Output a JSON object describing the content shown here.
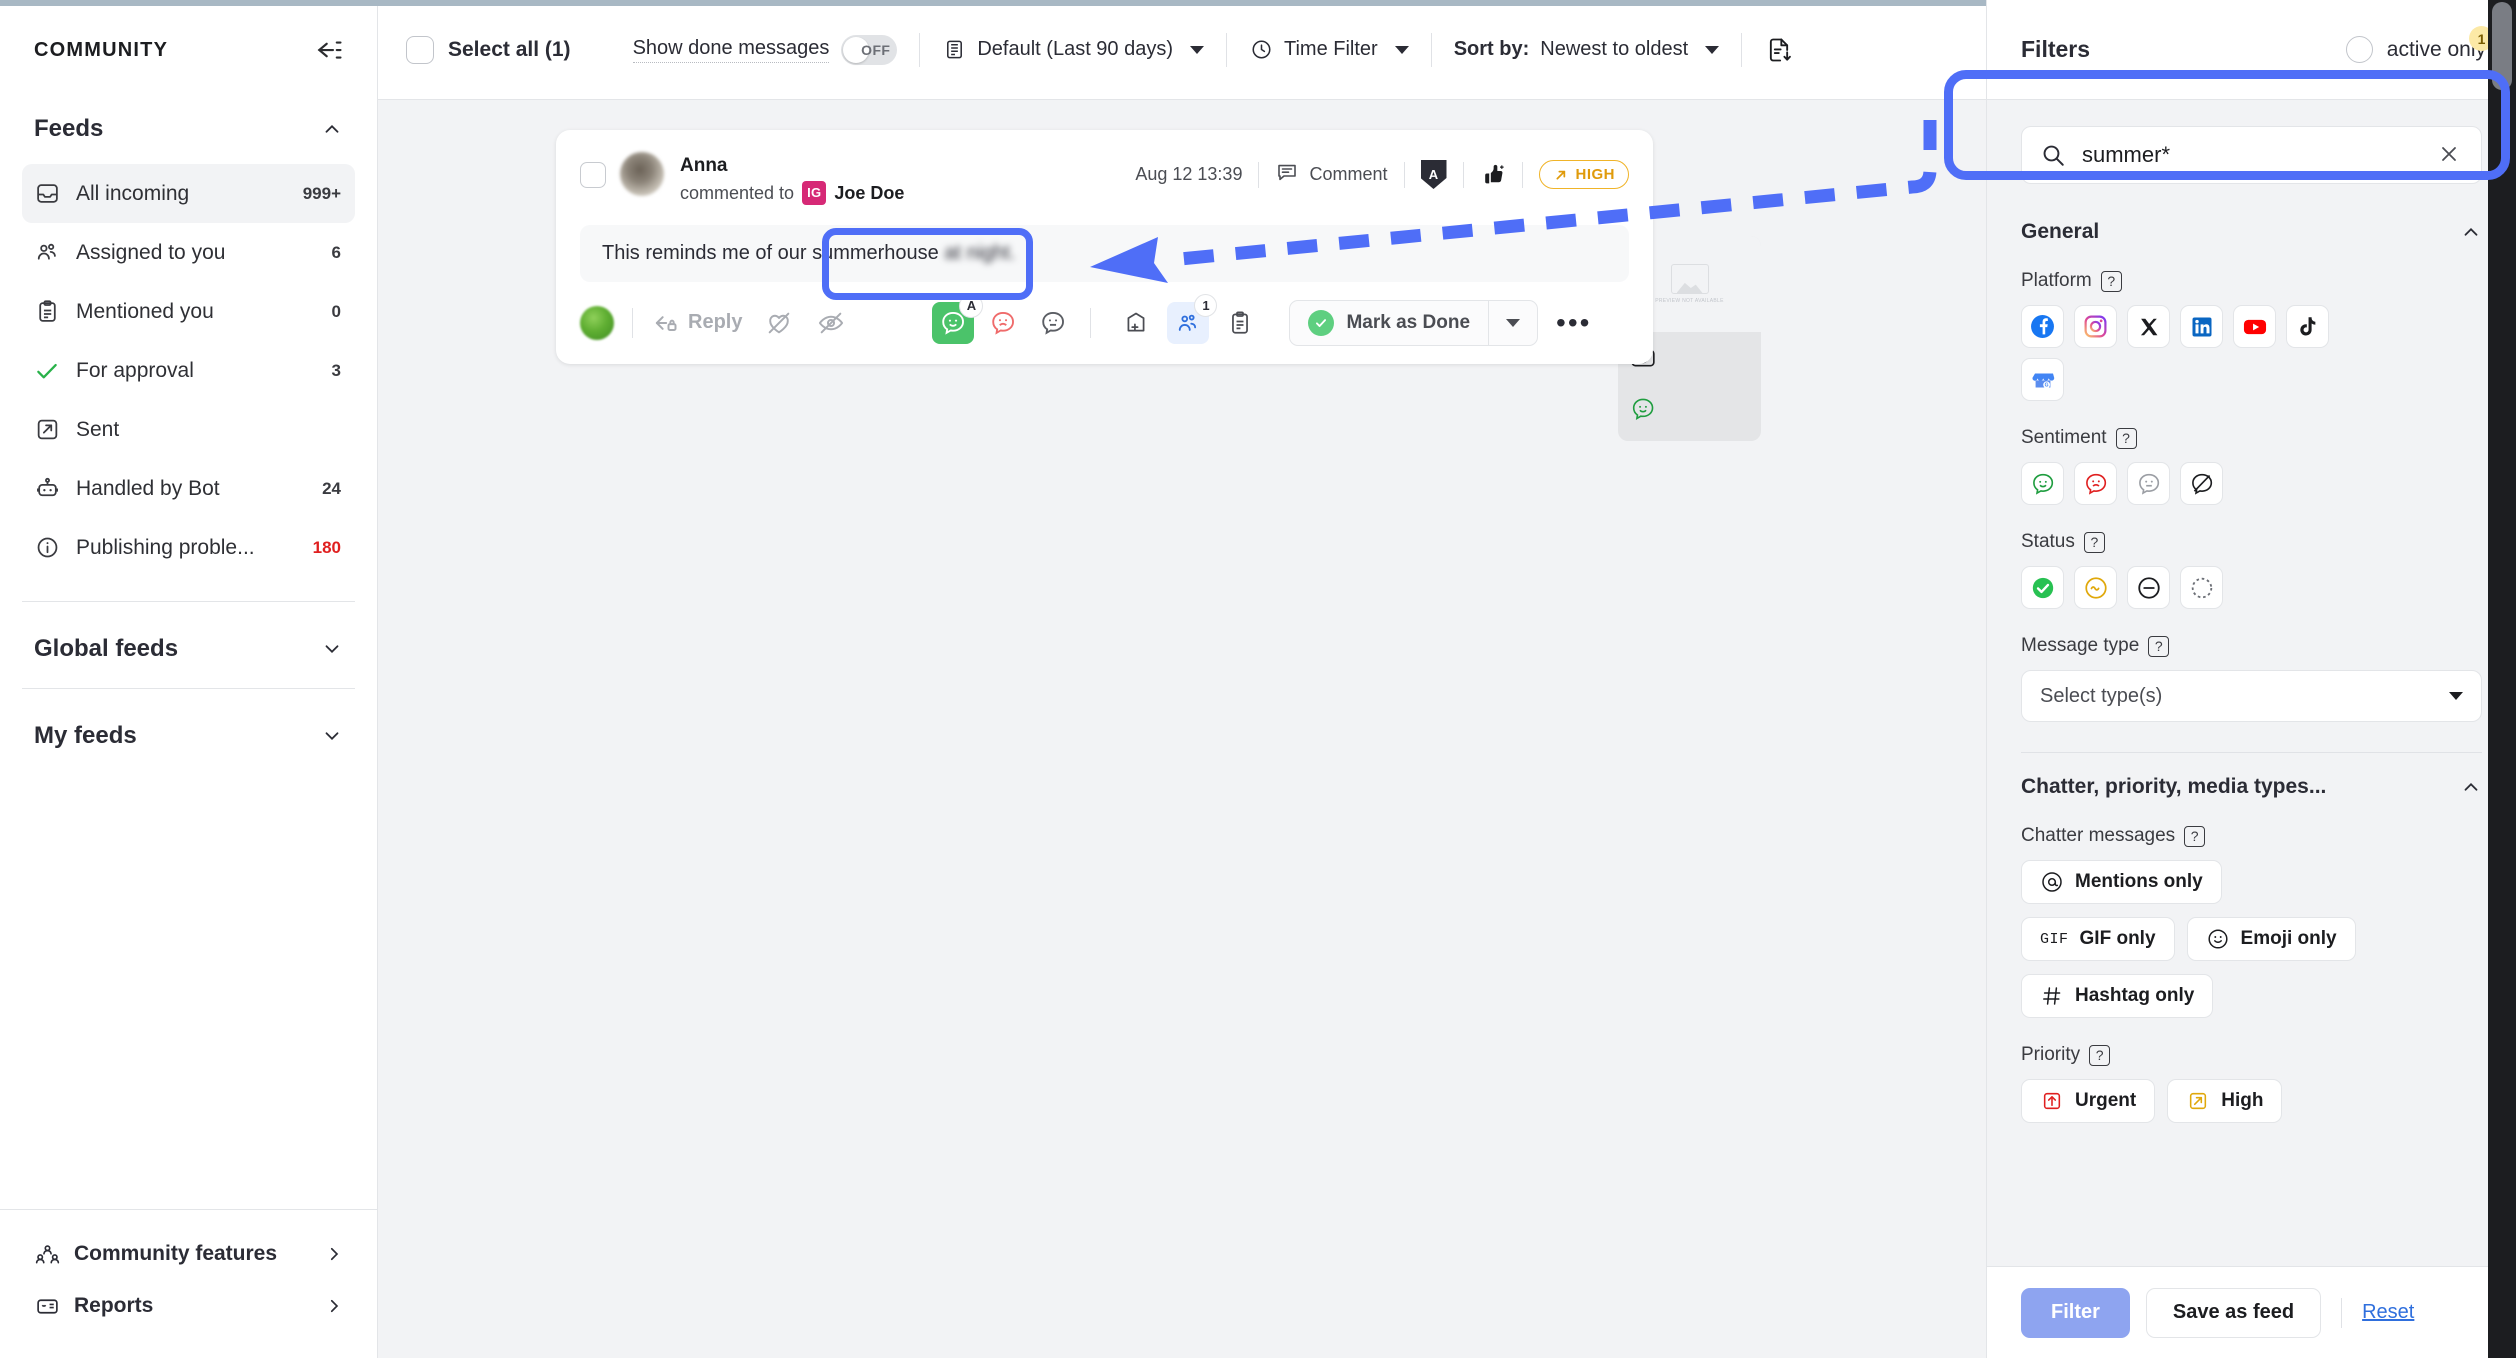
{
  "sidebar": {
    "title": "COMMUNITY",
    "collapse_icon": "collapse-left-icon",
    "feeds_section": {
      "label": "Feeds",
      "chevron": "chevron-up-icon"
    },
    "feeds": [
      {
        "icon": "inbox-icon",
        "label": "All incoming",
        "count": "999+",
        "active": true
      },
      {
        "icon": "people-icon",
        "label": "Assigned to you",
        "count": "6"
      },
      {
        "icon": "clipboard-icon",
        "label": "Mentioned you",
        "count": "0"
      },
      {
        "icon": "check-icon",
        "label": "For approval",
        "count": "3"
      },
      {
        "icon": "sent-arrow-icon",
        "label": "Sent",
        "count": ""
      },
      {
        "icon": "robot-icon",
        "label": "Handled by Bot",
        "count": "24"
      },
      {
        "icon": "info-icon",
        "label": "Publishing proble...",
        "count": "180"
      }
    ],
    "global_feeds": {
      "label": "Global feeds",
      "chevron": "chevron-down-icon"
    },
    "my_feeds": {
      "label": "My feeds",
      "chevron": "chevron-down-icon"
    },
    "footer": [
      {
        "icon": "community-icon",
        "label": "Community features",
        "arrow": "chevron-right-icon"
      },
      {
        "icon": "report-icon",
        "label": "Reports",
        "arrow": "chevron-right-icon"
      }
    ]
  },
  "toolbar": {
    "select_all": "Select all (1)",
    "show_done": "Show done messages",
    "toggle_state": "OFF",
    "date_filter": "Default (Last 90 days)",
    "time_filter": "Time Filter",
    "sort_prefix": "Sort by:",
    "sort_value": "Newest to oldest",
    "export_icon": "export-document-icon"
  },
  "message": {
    "author": "Anna",
    "action_prefix": "commented to",
    "platform_badge": "IG",
    "recipient": "Joe Doe",
    "timestamp": "Aug 12 13:39",
    "type_label": "Comment",
    "shield_letter": "A",
    "priority_label": "HIGH",
    "body_prefix": "This reminds me of our ",
    "body_highlight": "summerhouse",
    "body_suffix": " at night.",
    "reply_label": "Reply",
    "assignee_count": "1",
    "sentiment_badge": "A",
    "done_label": "Mark as Done",
    "more_label": "•••"
  },
  "preview_tile": {
    "placeholder_text": "PREVIEW NOT AVAILABLE",
    "camera_icon": "camera-icon",
    "sentiment_icon": "positive-sentiment-icon"
  },
  "filters": {
    "title": "Filters",
    "active_only_label": "active only",
    "active_only_badge": "1",
    "search_value": "summer*",
    "search_placeholder": "Search",
    "general": {
      "title": "General",
      "platform_label": "Platform",
      "platforms": [
        {
          "name": "facebook-icon",
          "label": "Facebook"
        },
        {
          "name": "instagram-icon",
          "label": "Instagram"
        },
        {
          "name": "x-twitter-icon",
          "label": "X"
        },
        {
          "name": "linkedin-icon",
          "label": "LinkedIn"
        },
        {
          "name": "youtube-icon",
          "label": "YouTube"
        },
        {
          "name": "tiktok-icon",
          "label": "TikTok"
        },
        {
          "name": "google-business-icon",
          "label": "Google Business"
        }
      ],
      "sentiment_label": "Sentiment",
      "sentiments": [
        {
          "name": "positive-sentiment-icon",
          "color": "#1f9d3f"
        },
        {
          "name": "negative-sentiment-icon",
          "color": "#e02020"
        },
        {
          "name": "neutral-sentiment-icon",
          "color": "#9b9ea4"
        },
        {
          "name": "no-sentiment-icon",
          "color": "#1c1d20"
        }
      ],
      "status_label": "Status",
      "statuses": [
        {
          "name": "status-done-icon",
          "color": "#28c152"
        },
        {
          "name": "status-in-progress-icon",
          "color": "#e0a80b"
        },
        {
          "name": "status-blocked-icon",
          "color": "#1c1d20"
        },
        {
          "name": "status-pending-icon",
          "color": "#6c6f76"
        }
      ],
      "message_type_label": "Message type",
      "message_type_placeholder": "Select type(s)"
    },
    "chatter": {
      "title": "Chatter, priority, media types...",
      "chatter_label": "Chatter messages",
      "chips": [
        {
          "icon": "at-mention-icon",
          "label": "Mentions only"
        },
        {
          "icon": "gif-icon",
          "label": "GIF only"
        },
        {
          "icon": "emoji-icon",
          "label": "Emoji only"
        },
        {
          "icon": "hashtag-icon",
          "label": "Hashtag only"
        }
      ],
      "priority_label": "Priority",
      "priorities": [
        {
          "icon": "arrow-up-icon",
          "label": "Urgent",
          "color": "#e02020"
        },
        {
          "icon": "arrow-up-right-icon",
          "label": "High",
          "color": "#e0a80b"
        }
      ]
    },
    "footer": {
      "filter_label": "Filter",
      "save_label": "Save as feed",
      "reset_label": "Reset"
    }
  },
  "colors": {
    "accent_blue": "#4f6ef7",
    "brand_button": "#8ea4f0",
    "link": "#2f6fdd",
    "danger": "#e02020",
    "warning": "#e0a80b",
    "success": "#28c152"
  }
}
